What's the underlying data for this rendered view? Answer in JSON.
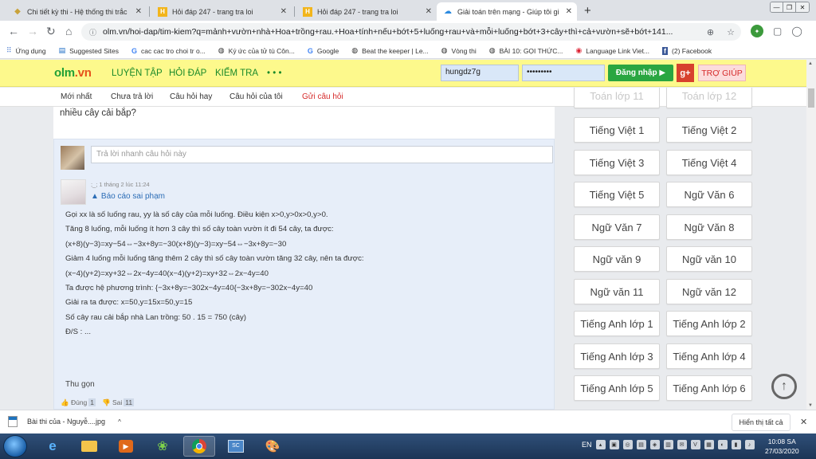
{
  "tabs": [
    {
      "title": "Chi tiết kỳ thi - Hệ thống thi trắc",
      "icon": "diamond-icon"
    },
    {
      "title": "Hỏi đáp 247 - trang tra loi",
      "icon": "h-logo-icon"
    },
    {
      "title": "Hỏi đáp 247 - trang tra loi",
      "icon": "h-logo-icon"
    },
    {
      "title": "Giải toán trên mạng - Giúp tôi gi",
      "icon": "cloud-icon"
    }
  ],
  "address": {
    "url": "olm.vn/hoi-dap/tim-kiem?q=mảnh+vườn+nhà+Hoa+trồng+rau.+Hoa+tính+nếu+bớt+5+luống+rau+và+mỗi+luống+bớt+3+cây+thì+cả+vườn+sẽ+bớt+141..."
  },
  "bookmarks": [
    {
      "label": "Ứng dụng",
      "icon": "apps-grid-icon"
    },
    {
      "label": "Suggested Sites",
      "icon": "suggested-sites-icon"
    },
    {
      "label": "cac cac tro choi tr o...",
      "icon": "google-icon"
    },
    {
      "label": "Ký ức của tử tù Côn...",
      "icon": "globe-icon"
    },
    {
      "label": "Google",
      "icon": "google-icon"
    },
    {
      "label": "Beat the keeper | Le...",
      "icon": "globe-icon"
    },
    {
      "label": "Vòng thi",
      "icon": "globe-icon"
    },
    {
      "label": "BÀI 10: GỌI THỨC...",
      "icon": "globe-icon"
    },
    {
      "label": "Language Link Viet...",
      "icon": "map-pin-icon"
    },
    {
      "label": "(2) Facebook",
      "icon": "facebook-icon"
    }
  ],
  "site": {
    "logo_o": "o",
    "logo_lm": "lm",
    "logo_vn": ".vn",
    "nav": [
      "LUYỆN TẬP",
      "HỎI ĐÁP",
      "KIỂM TRA",
      "• • •"
    ],
    "username": "hungdz7g",
    "password": "•••••••••",
    "login_label": "Đăng nhập ▶",
    "gplus_label": "g+",
    "help_label": "TRỢ GIÚP"
  },
  "subnav": [
    {
      "label": "Mới nhất"
    },
    {
      "label": "Chưa trả lời"
    },
    {
      "label": "Câu hỏi hay"
    },
    {
      "label": "Câu hỏi của tôi"
    },
    {
      "label": "Gửi câu hỏi"
    }
  ],
  "question": {
    "tail": "nhiều cây cải bắp?"
  },
  "reply": {
    "placeholder": "Trả lời nhanh câu hỏi này"
  },
  "answer": {
    "meta": ";_; 1 tháng 2 lúc 11:24",
    "report": "Báo cáo sai phạm",
    "lines": [
      "Gọi xx là số luống rau, yy là số cây của mỗi luống. Điều kiện x>0,y>0x>0,y>0.",
      "Tăng 8 luống, mỗi luống ít hơn 3 cây thì số cây toàn vườn ít đi 54 cây, ta được:",
      "(x+8)(y−3)=xy−54⇔−3x+8y=−30(x+8)(y−3)=xy−54⇔−3x+8y=−30",
      "Giảm 4 luống mỗi luống tăng thêm 2 cây thì số cây toàn vườn tăng 32 cây, nên ta được:",
      "(x−4)(y+2)=xy+32⇔2x−4y=40(x−4)(y+2)=xy+32⇔2x−4y=40",
      "Ta được hệ phương trình: {−3x+8y=−302x−4y=40{−3x+8y=−302x−4y=40",
      "Giải ra ta được: x=50,y=15x=50,y=15",
      "Số cây rau cải bắp nhà Lan trồng: 50 . 15 = 750 (cây)",
      "Đ/S : ..."
    ],
    "collapse": "Thu gọn",
    "upvote_label": "Đúng",
    "upvote_count": "1",
    "downvote_label": "Sai",
    "downvote_count": "11"
  },
  "sidebar": {
    "faded": [
      "Toán lớp 11",
      "Toán lớp 12"
    ],
    "buttons": [
      "Tiếng Việt 1",
      "Tiếng Việt 2",
      "Tiếng Việt 3",
      "Tiếng Việt 4",
      "Tiếng Việt 5",
      "Ngữ Văn 6",
      "Ngữ Văn 7",
      "Ngữ Văn 8",
      "Ngữ văn 9",
      "Ngữ văn 10",
      "Ngữ văn 11",
      "Ngữ văn 12",
      "Tiếng Anh lớp 1",
      "Tiếng Anh lớp 2",
      "Tiếng Anh lớp 3",
      "Tiếng Anh lớp 4",
      "Tiếng Anh lớp 5",
      "Tiếng Anh lớp 6"
    ]
  },
  "downloads": {
    "file": "Bài thi của - Nguyễ....jpg",
    "show_all": "Hiển thị tất cả"
  },
  "taskbar": {
    "lang": "EN",
    "time": "10:08 SA",
    "date": "27/03/2020"
  }
}
